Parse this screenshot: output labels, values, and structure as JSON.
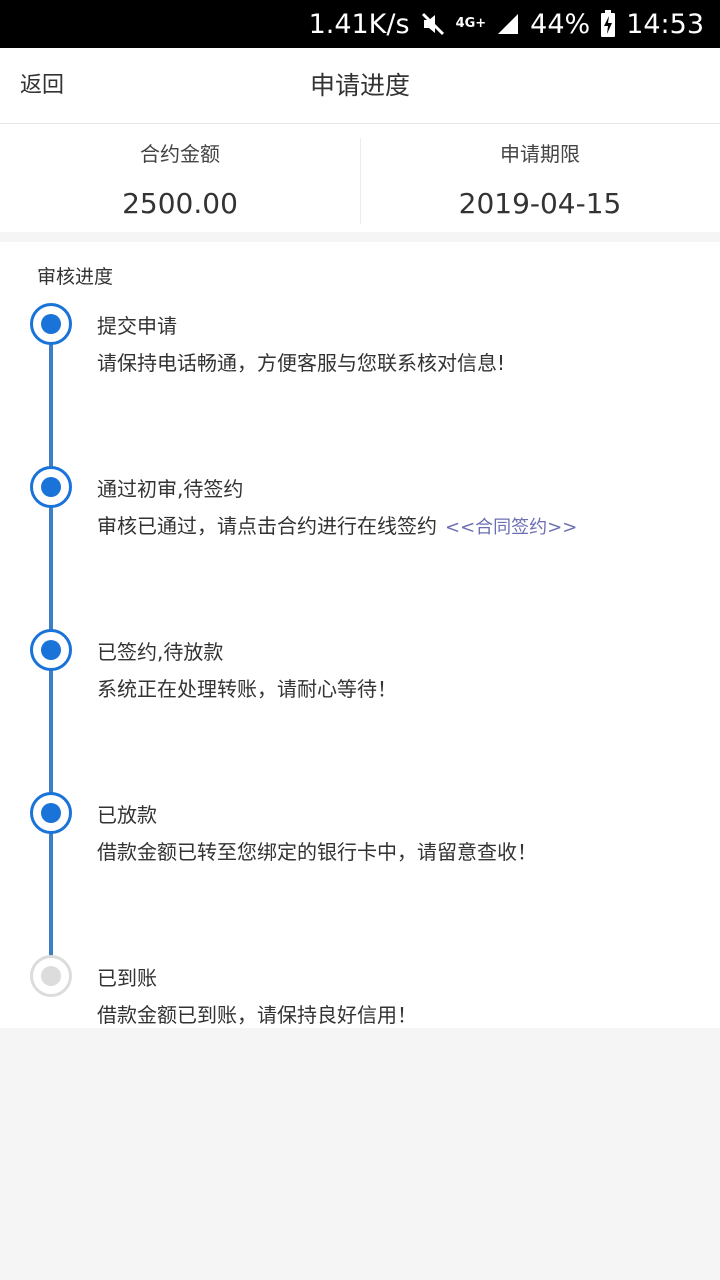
{
  "status_bar": {
    "speed": "1.41K/s",
    "network": "4G+",
    "battery": "44%",
    "time": "14:53",
    "icons": [
      "mute-icon",
      "network-arrows-icon",
      "signal-icon",
      "battery-charging-icon"
    ]
  },
  "nav": {
    "back_label": "返回",
    "title": "申请进度"
  },
  "summary": {
    "amount_label": "合约金额",
    "amount_value": "2500.00",
    "date_label": "申请期限",
    "date_value": "2019-04-15"
  },
  "progress": {
    "title": "审核进度",
    "steps": [
      {
        "title": "提交申请",
        "desc": "请保持电话畅通，方便客服与您联系核对信息!",
        "active": true
      },
      {
        "title": "通过初审,待签约",
        "desc": "审核已通过，请点击合约进行在线签约",
        "link": "<<合同签约>>",
        "active": true
      },
      {
        "title": "已签约,待放款",
        "desc": "系统正在处理转账，请耐心等待！",
        "active": true
      },
      {
        "title": "已放款",
        "desc": "借款金额已转至您绑定的银行卡中，请留意查收！",
        "active": true
      },
      {
        "title": "已到账",
        "desc": "借款金额已到账，请保持良好信用！",
        "active": false
      }
    ]
  },
  "colors": {
    "accent": "#1a73d9",
    "timeline": "#3d7fc4",
    "link": "#6a6fb3",
    "inactive": "#dcdcdc"
  }
}
